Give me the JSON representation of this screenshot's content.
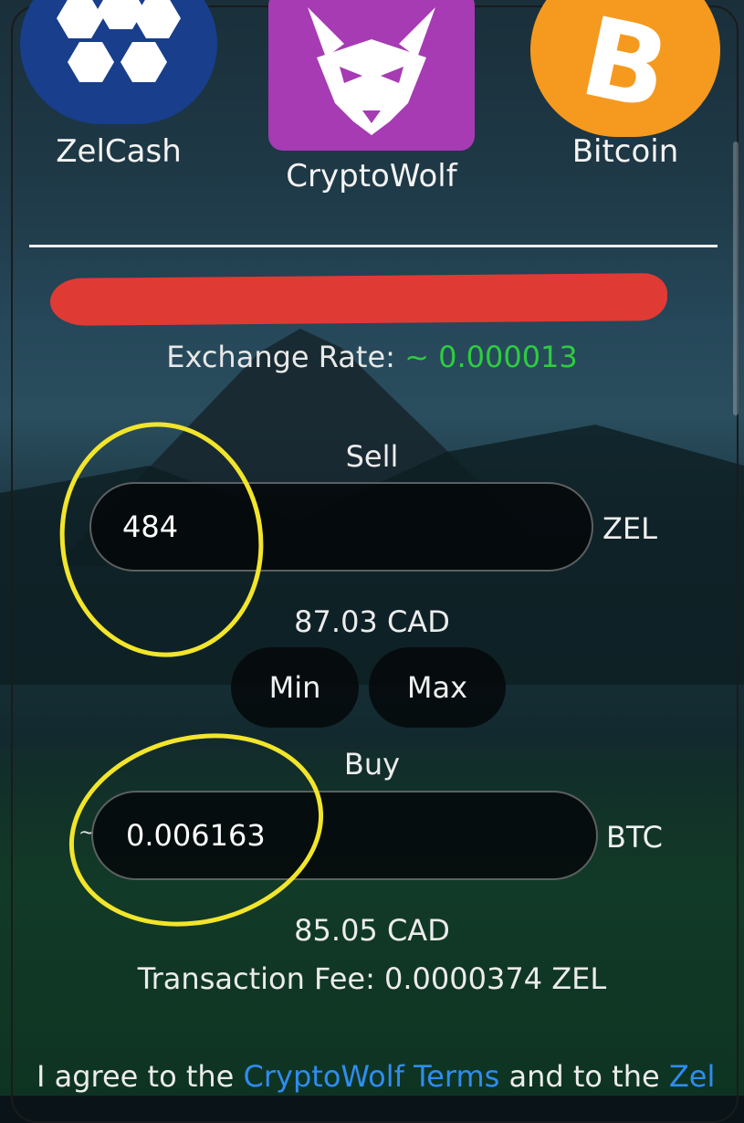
{
  "coins": [
    {
      "name": "ZelCash",
      "icon": "zelcash-hexagon-logo",
      "color": "#183e8c"
    },
    {
      "name": "CryptoWolf",
      "icon": "cryptowolf-wolf-logo",
      "color": "#a63bb3"
    },
    {
      "name": "Bitcoin",
      "icon": "bitcoin-logo",
      "color": "#f59a1f"
    }
  ],
  "exchange": {
    "rate_label": "Exchange Rate:",
    "rate_value": "~ 0.000013"
  },
  "sell": {
    "label": "Sell",
    "amount": "484",
    "unit": "ZEL",
    "fiat": "87.03 CAD"
  },
  "buttons": {
    "min": "Min",
    "max": "Max"
  },
  "buy": {
    "label": "Buy",
    "prefix": "~",
    "amount": "0.006163",
    "unit": "BTC",
    "fiat": "85.05 CAD"
  },
  "fee": {
    "text": "Transaction Fee: 0.0000374 ZEL"
  },
  "terms": {
    "prefix": "I agree to the ",
    "link1": "CryptoWolf Terms",
    "middle": " and to the ",
    "link2": "Zel"
  },
  "colors": {
    "rate_green": "#2ecc40",
    "link_blue": "#2f8cf0",
    "annotation_yellow": "#f2e52a",
    "redaction_red": "#e03a34"
  }
}
